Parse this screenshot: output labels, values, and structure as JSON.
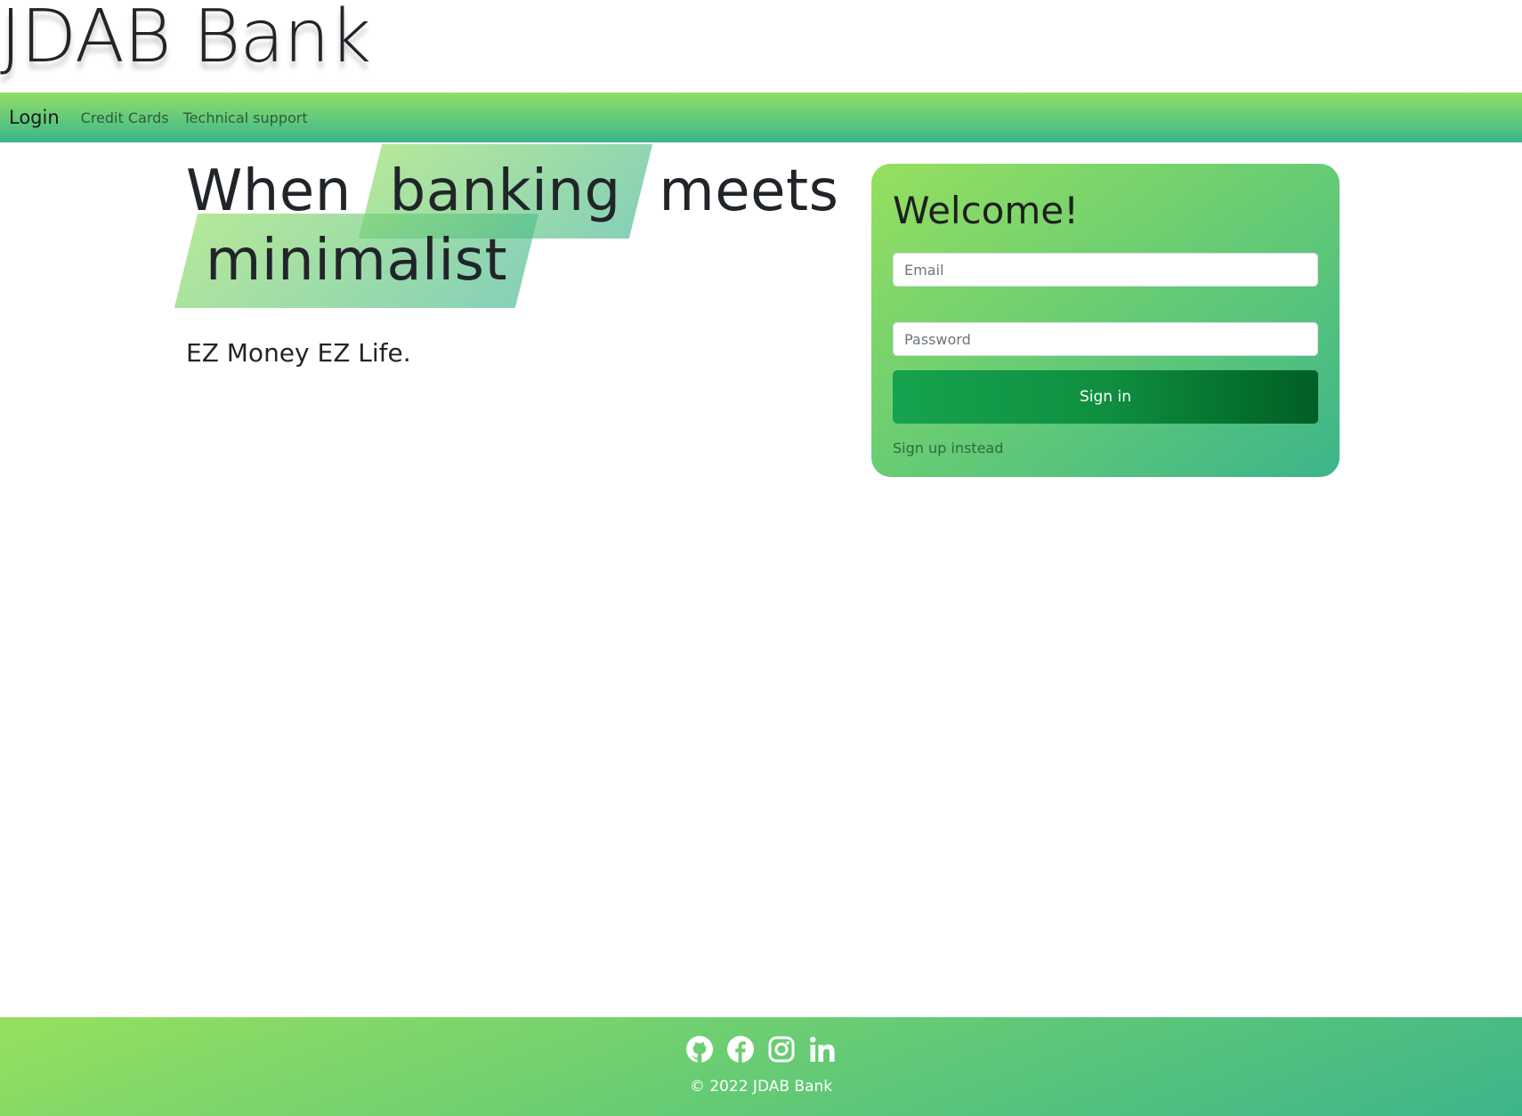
{
  "brand": {
    "title": "JDAB Bank"
  },
  "navbar": {
    "brand_label": "Login",
    "links": [
      {
        "label": "Credit Cards"
      },
      {
        "label": "Technical support"
      }
    ]
  },
  "hero": {
    "word_when": "When",
    "word_banking": "banking",
    "word_meets": "meets",
    "word_minimalist": "minimalist",
    "tagline": "EZ Money EZ Life."
  },
  "login_card": {
    "title": "Welcome!",
    "email": {
      "value": "",
      "placeholder": "Email"
    },
    "password": {
      "value": "",
      "placeholder": "Password"
    },
    "signin_label": "Sign in",
    "signup_label": "Sign up instead"
  },
  "footer": {
    "social_icons": [
      "github-icon",
      "facebook-icon",
      "instagram-icon",
      "linkedin-icon"
    ],
    "copyright": "© 2022 JDAB Bank"
  },
  "colors": {
    "gradient_light": "#96e05f",
    "gradient_dark": "#3cb58a",
    "button_start": "#16a34f",
    "button_end": "#005e25"
  }
}
